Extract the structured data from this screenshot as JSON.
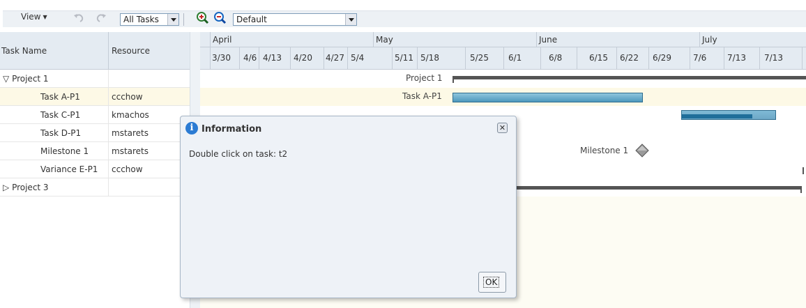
{
  "toolbar": {
    "view_label": "View",
    "task_filter_value": "All Tasks",
    "zoom_in_icon": "zoom-in-icon",
    "zoom_out_icon": "zoom-out-icon",
    "undo_icon": "undo-icon",
    "redo_icon": "redo-icon",
    "layout_value": "Default"
  },
  "table": {
    "headers": {
      "task_name": "Task Name",
      "resource": "Resource"
    },
    "rows": [
      {
        "name": "Project 1",
        "resource": "",
        "expander": "▽"
      },
      {
        "name": "Task A-P1",
        "resource": "ccchow"
      },
      {
        "name": "Task C-P1",
        "resource": "kmachos"
      },
      {
        "name": "Task D-P1",
        "resource": "mstarets"
      },
      {
        "name": "Milestone 1",
        "resource": "mstarets"
      },
      {
        "name": "Variance E-P1",
        "resource": "ccchow"
      },
      {
        "name": "Project 3",
        "resource": "",
        "expander": "▷"
      }
    ]
  },
  "timeline": {
    "months": [
      "April",
      "May",
      "June",
      "July"
    ],
    "weeks": [
      "3/30",
      "4/6",
      "4/13",
      "4/20",
      "4/27",
      "5/4",
      "5/11",
      "5/18",
      "5/25",
      "6/1",
      "6/8",
      "6/15",
      "6/22",
      "6/29",
      "7/6",
      "7/13"
    ]
  },
  "gantt": {
    "project1_label": "Project 1",
    "taskA_label": "Task A-P1",
    "milestone_label": "Milestone 1"
  },
  "dialog": {
    "title": "Information",
    "message": "Double click on task: t2",
    "ok_label": "OK",
    "close_glyph": "✕"
  },
  "colors": {
    "selected_row": "#fdf9e6",
    "header_bg": "#e4ebf2",
    "task_bar": "#4e98bd"
  }
}
